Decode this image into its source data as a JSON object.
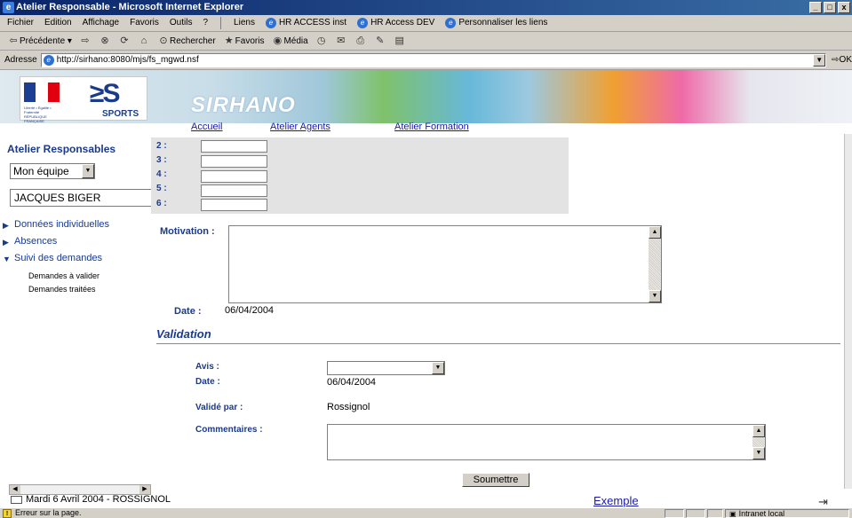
{
  "window": {
    "title": "Atelier Responsable - Microsoft Internet Explorer",
    "controls": [
      "_",
      "□",
      "x"
    ]
  },
  "menu": {
    "items": [
      "Fichier",
      "Edition",
      "Affichage",
      "Favoris",
      "Outils",
      "?"
    ],
    "links_label": "Liens",
    "links": [
      "HR ACCESS inst",
      "HR Access DEV",
      "Personnaliser les liens"
    ]
  },
  "toolbar": {
    "back": "Précédente",
    "search": "Rechercher",
    "favorites": "Favoris",
    "media": "Média"
  },
  "address": {
    "label": "Adresse",
    "url": "http://sirhano:8080/mjs/fs_mgwd.nsf",
    "go": "OK"
  },
  "banner": {
    "logo_text": "SPORTS",
    "logo_caption": "Liberté • Égalité • Fraternité RÉPUBLIQUE FRANÇAISE",
    "app_name": "SIRHANO"
  },
  "nav": {
    "links": [
      "Accueil",
      "Atelier Agents",
      "Atelier Formation"
    ]
  },
  "sidebar": {
    "title": "Atelier Responsables",
    "team_select": "Mon équipe",
    "person": "JACQUES BIGER",
    "menu": [
      {
        "label": "Données individuelles"
      },
      {
        "label": "Absences"
      },
      {
        "label": "Suivi des demandes"
      }
    ],
    "submenu": [
      "Demandes à valider",
      "Demandes traitées"
    ]
  },
  "form": {
    "rows": [
      "2 :",
      "3 :",
      "4 :",
      "5 :",
      "6 :"
    ],
    "motivation_label": "Motivation :",
    "date_label": "Date :",
    "date_value": "06/04/2004",
    "validation_heading": "Validation",
    "avis_label": "Avis :",
    "avis_value": "",
    "validation_date_label": "Date :",
    "validation_date_value": "06/04/2004",
    "validated_by_label": "Validé par :",
    "validated_by_value": "Rossignol",
    "comments_label": "Commentaires :",
    "submit_label": "Soumettre"
  },
  "footer": {
    "user_date": "Mardi 6 Avril 2004 - ROSSIGNOL",
    "example_link": "Exemple"
  },
  "status": {
    "message": "Erreur sur la page.",
    "zone": "Intranet local"
  }
}
